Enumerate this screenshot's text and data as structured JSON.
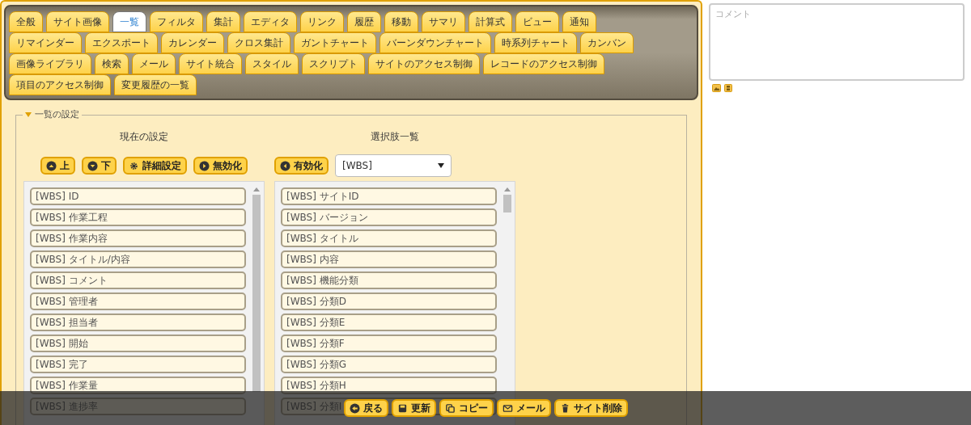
{
  "tab_rows": [
    [
      {
        "label": "全般",
        "selected": false
      },
      {
        "label": "サイト画像",
        "selected": false
      },
      {
        "label": "一覧",
        "selected": true
      },
      {
        "label": "フィルタ",
        "selected": false
      },
      {
        "label": "集計",
        "selected": false
      },
      {
        "label": "エディタ",
        "selected": false
      },
      {
        "label": "リンク",
        "selected": false
      },
      {
        "label": "履歴",
        "selected": false
      },
      {
        "label": "移動",
        "selected": false
      },
      {
        "label": "サマリ",
        "selected": false
      },
      {
        "label": "計算式",
        "selected": false
      },
      {
        "label": "ビュー",
        "selected": false
      },
      {
        "label": "通知",
        "selected": false
      }
    ],
    [
      {
        "label": "リマインダー",
        "selected": false
      },
      {
        "label": "エクスポート",
        "selected": false
      },
      {
        "label": "カレンダー",
        "selected": false
      },
      {
        "label": "クロス集計",
        "selected": false
      },
      {
        "label": "ガントチャート",
        "selected": false
      },
      {
        "label": "バーンダウンチャート",
        "selected": false
      },
      {
        "label": "時系列チャート",
        "selected": false
      },
      {
        "label": "カンバン",
        "selected": false
      }
    ],
    [
      {
        "label": "画像ライブラリ",
        "selected": false
      },
      {
        "label": "検索",
        "selected": false
      },
      {
        "label": "メール",
        "selected": false
      },
      {
        "label": "サイト統合",
        "selected": false
      },
      {
        "label": "スタイル",
        "selected": false
      },
      {
        "label": "スクリプト",
        "selected": false
      },
      {
        "label": "サイトのアクセス制御",
        "selected": false
      },
      {
        "label": "レコードのアクセス制御",
        "selected": false
      }
    ],
    [
      {
        "label": "項目のアクセス制御",
        "selected": false
      },
      {
        "label": "変更履歴の一覧",
        "selected": false
      }
    ]
  ],
  "section": {
    "legend": "一覧の設定",
    "expanded": true,
    "current": {
      "heading": "現在の設定",
      "buttons": [
        "上",
        "下",
        "詳細設定",
        "無効化"
      ],
      "items": [
        "[WBS] ID",
        "[WBS] 作業工程",
        "[WBS] 作業内容",
        "[WBS] タイトル/内容",
        "[WBS] コメント",
        "[WBS] 管理者",
        "[WBS] 担当者",
        "[WBS] 開始",
        "[WBS] 完了",
        "[WBS] 作業量",
        "[WBS] 進捗率"
      ]
    },
    "choices": {
      "heading": "選択肢一覧",
      "buttons": [
        "有効化"
      ],
      "filter": "[WBS]",
      "items": [
        "[WBS] サイトID",
        "[WBS] バージョン",
        "[WBS] タイトル",
        "[WBS] 内容",
        "[WBS] 機能分類",
        "[WBS] 分類D",
        "[WBS] 分類E",
        "[WBS] 分類F",
        "[WBS] 分類G",
        "[WBS] 分類H",
        "[WBS] 分類I"
      ]
    }
  },
  "comment": {
    "placeholder": "コメント"
  },
  "footer_buttons": [
    "戻る",
    "更新",
    "コピー",
    "メール",
    "サイト削除"
  ]
}
